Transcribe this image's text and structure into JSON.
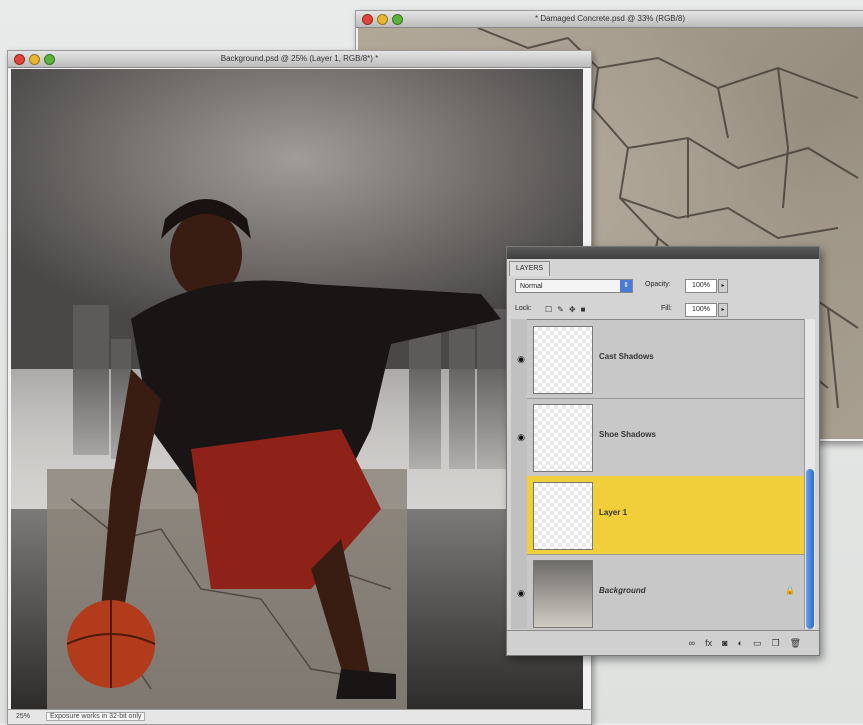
{
  "windows": {
    "concrete": {
      "title": "* Damaged Concrete.psd @ 33% (RGB/8)"
    },
    "background": {
      "title": "Background.psd @ 25% (Layer 1, RGB/8*) *"
    }
  },
  "status": {
    "zoom": "25%",
    "message": "Exposure works in 32-bit only"
  },
  "layers_panel": {
    "tab": "LAYERS",
    "blend_mode": "Normal",
    "opacity_label": "Opacity:",
    "opacity_value": "100%",
    "lock_label": "Lock:",
    "fill_label": "Fill:",
    "fill_value": "100%",
    "layers": [
      {
        "name": "Cast Shadows",
        "visible": true,
        "selected": false
      },
      {
        "name": "Shoe Shadows",
        "visible": true,
        "selected": false
      },
      {
        "name": "Layer 1",
        "visible": false,
        "selected": true
      },
      {
        "name": "Background",
        "visible": true,
        "selected": false,
        "locked": true
      }
    ],
    "selection_color": "#f0cf3a"
  }
}
